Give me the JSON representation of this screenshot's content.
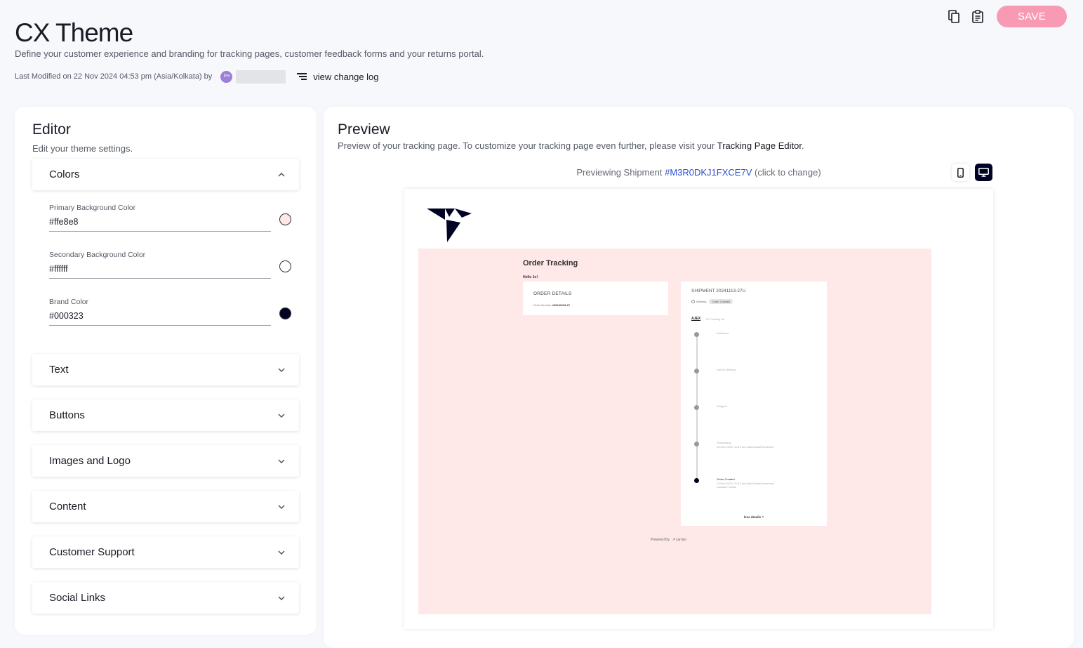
{
  "header": {
    "title": "CX Theme",
    "subtitle": "Define your customer experience and branding for tracking pages, customer feedback forms and your returns portal.",
    "last_modified": "Last Modified on 22 Nov 2024 04:53 pm (Asia/Kolkata) by",
    "avatar_initials": "PH",
    "change_log_label": "view change log",
    "save_label": "SAVE",
    "save_color": "#f89ab3"
  },
  "editor": {
    "title": "Editor",
    "subtitle": "Edit your theme settings.",
    "colors_section": {
      "label": "Colors",
      "fields": [
        {
          "label": "Primary Background Color",
          "value": "#ffe8e8",
          "swatch": "#ffe8e8"
        },
        {
          "label": "Secondary Background Color",
          "value": "#ffffff",
          "swatch": "#ffffff"
        },
        {
          "label": "Brand Color",
          "value": "#000323",
          "swatch": "#000323"
        }
      ]
    },
    "sections": [
      "Text",
      "Buttons",
      "Images and Logo",
      "Content",
      "Customer Support",
      "Social Links"
    ]
  },
  "preview": {
    "title": "Preview",
    "subtitle": "Preview of your tracking page. To customize your tracking page even further, please visit your",
    "subtitle_link": "Tracking Page Editor",
    "subtitle_end": ".",
    "shipment_prefix": "Previewing Shipment",
    "shipment_id": "#M3R0DKJ1FXCE7V",
    "shipment_suffix": "(click to change)",
    "tracking_page": {
      "title": "Order Tracking",
      "greeting": "Hello Jo!",
      "order_details_title": "ORDER DETAILS",
      "order_number_label": "Order Number",
      "order_number": "#20241113-27",
      "shipment_title": "SHIPMENT 20241113-27U",
      "delivery_label": "Delivery",
      "status_chip": "Order Created",
      "carrier": "AJEX",
      "carrier_sub": "XXX Tracking No.",
      "timeline": [
        {
          "label": "Delivered",
          "detail": "",
          "active": false
        },
        {
          "label": "Out for Delivery",
          "detail": "",
          "active": false
        },
        {
          "label": "Shipped",
          "detail": "",
          "active": false
        },
        {
          "label": "Processing",
          "detail": "13 Nov 2024, 11:43 am (Asia/Dubai timezone)",
          "active": false
        },
        {
          "label": "Order Created",
          "detail": "13 Nov 2024, 11:43 am (Asia/Dubai timezone)",
          "location": "Location: Dubai",
          "active": true
        }
      ],
      "less_details": "less details",
      "powered_by": "Powered By",
      "powered_brand": "carriyo"
    }
  }
}
